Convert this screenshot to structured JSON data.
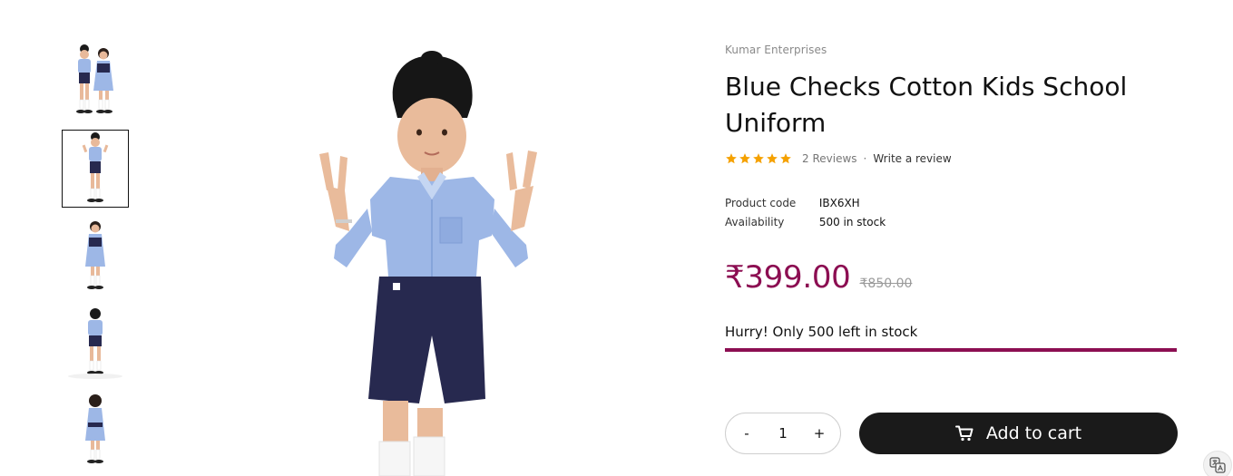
{
  "product": {
    "vendor": "Kumar Enterprises",
    "title": "Blue Checks Cotton Kids School Uniform",
    "rating": 5,
    "reviews_label": "2 Reviews",
    "separator": "·",
    "write_review_label": "Write a review",
    "code_label": "Product code",
    "code_value": "IBX6XH",
    "availability_label": "Availability",
    "availability_value": "500 in stock",
    "price": "₹399.00",
    "compare_price": "₹850.00",
    "stock_message": "Hurry! Only 500 left in stock",
    "stock_fraction": 1.0
  },
  "quantity": {
    "minus": "-",
    "value": "1",
    "plus": "+"
  },
  "cart": {
    "add_label": "Add to cart"
  },
  "colors": {
    "accent": "#8c0e52",
    "star": "#f5a100",
    "button": "#1a1a1a",
    "shirt": "#9db7e6",
    "shorts": "#27294f"
  },
  "icons": [
    "star-icon",
    "cart-icon",
    "translate-icon"
  ]
}
